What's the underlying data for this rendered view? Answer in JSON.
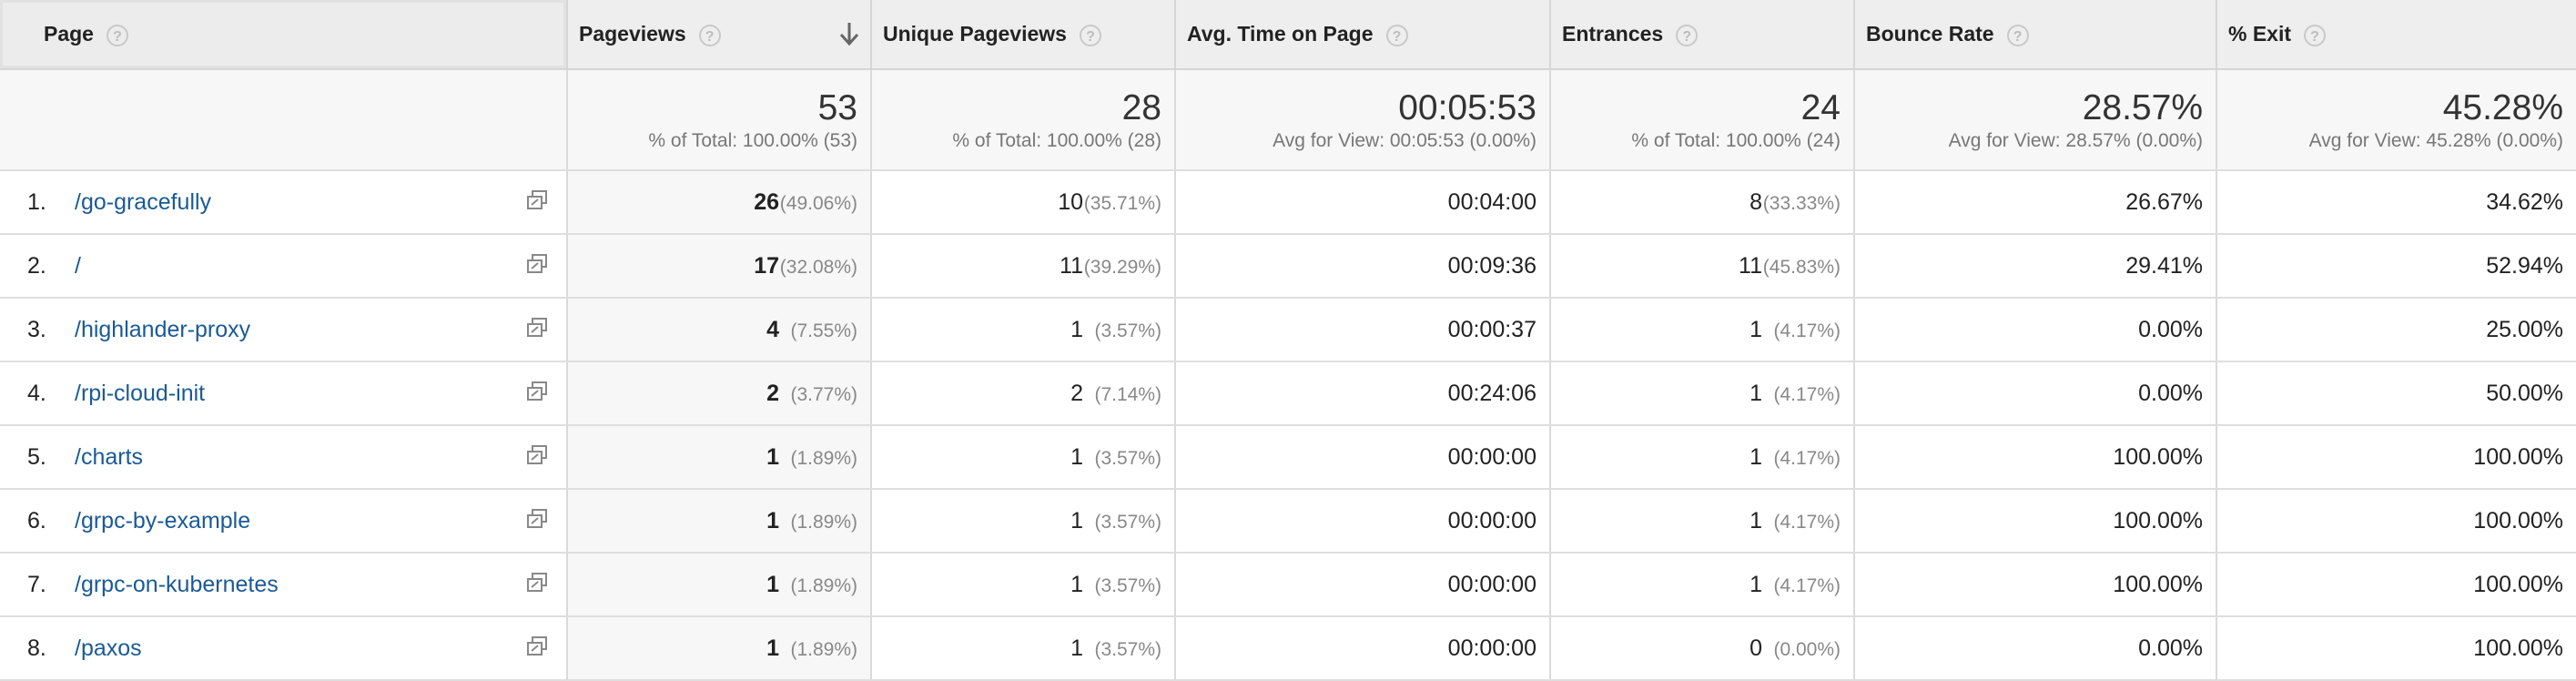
{
  "headers": {
    "page": "Page",
    "pageviews": "Pageviews",
    "unique_pageviews": "Unique Pageviews",
    "avg_time": "Avg. Time on Page",
    "entrances": "Entrances",
    "bounce_rate": "Bounce Rate",
    "exit": "% Exit",
    "help_glyph": "?"
  },
  "summary": {
    "pageviews": "53",
    "pageviews_sub": "% of Total: 100.00% (53)",
    "unique_pageviews": "28",
    "unique_pageviews_sub": "% of Total: 100.00% (28)",
    "avg_time": "00:05:53",
    "avg_time_sub": "Avg for View: 00:05:53 (0.00%)",
    "entrances": "24",
    "entrances_sub": "% of Total: 100.00% (24)",
    "bounce_rate": "28.57%",
    "bounce_rate_sub": "Avg for View: 28.57% (0.00%)",
    "exit": "45.28%",
    "exit_sub": "Avg for View: 45.28% (0.00%)"
  },
  "rows": [
    {
      "rank": "1.",
      "page": "/go-gracefully",
      "pv": "26",
      "pv_pct": "(49.06%)",
      "upv": "10",
      "upv_pct": "(35.71%)",
      "time": "00:04:00",
      "ent": "8",
      "ent_pct": "(33.33%)",
      "br": "26.67%",
      "exit": "34.62%"
    },
    {
      "rank": "2.",
      "page": "/",
      "pv": "17",
      "pv_pct": "(32.08%)",
      "upv": "11",
      "upv_pct": "(39.29%)",
      "time": "00:09:36",
      "ent": "11",
      "ent_pct": "(45.83%)",
      "br": "29.41%",
      "exit": "52.94%"
    },
    {
      "rank": "3.",
      "page": "/highlander-proxy",
      "pv": "4",
      "pv_pct": "(7.55%)",
      "upv": "1",
      "upv_pct": "(3.57%)",
      "time": "00:00:37",
      "ent": "1",
      "ent_pct": "(4.17%)",
      "br": "0.00%",
      "exit": "25.00%"
    },
    {
      "rank": "4.",
      "page": "/rpi-cloud-init",
      "pv": "2",
      "pv_pct": "(3.77%)",
      "upv": "2",
      "upv_pct": "(7.14%)",
      "time": "00:24:06",
      "ent": "1",
      "ent_pct": "(4.17%)",
      "br": "0.00%",
      "exit": "50.00%"
    },
    {
      "rank": "5.",
      "page": "/charts",
      "pv": "1",
      "pv_pct": "(1.89%)",
      "upv": "1",
      "upv_pct": "(3.57%)",
      "time": "00:00:00",
      "ent": "1",
      "ent_pct": "(4.17%)",
      "br": "100.00%",
      "exit": "100.00%"
    },
    {
      "rank": "6.",
      "page": "/grpc-by-example",
      "pv": "1",
      "pv_pct": "(1.89%)",
      "upv": "1",
      "upv_pct": "(3.57%)",
      "time": "00:00:00",
      "ent": "1",
      "ent_pct": "(4.17%)",
      "br": "100.00%",
      "exit": "100.00%"
    },
    {
      "rank": "7.",
      "page": "/grpc-on-kubernetes",
      "pv": "1",
      "pv_pct": "(1.89%)",
      "upv": "1",
      "upv_pct": "(3.57%)",
      "time": "00:00:00",
      "ent": "1",
      "ent_pct": "(4.17%)",
      "br": "100.00%",
      "exit": "100.00%"
    },
    {
      "rank": "8.",
      "page": "/paxos",
      "pv": "1",
      "pv_pct": "(1.89%)",
      "upv": "1",
      "upv_pct": "(3.57%)",
      "time": "00:00:00",
      "ent": "0",
      "ent_pct": "(0.00%)",
      "br": "0.00%",
      "exit": "100.00%"
    }
  ],
  "colors": {
    "link": "#1a5a96",
    "header_bg": "#eeeeee",
    "summary_bg": "#f7f7f7"
  },
  "icons": {
    "sort": "sort-arrow-down-icon",
    "open_page": "popout-icon",
    "help": "help-icon"
  }
}
